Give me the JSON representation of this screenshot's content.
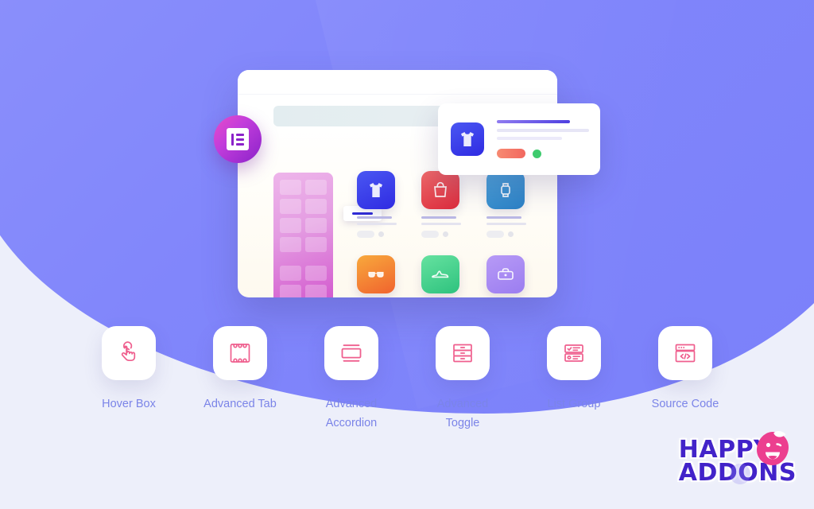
{
  "palette": {
    "background": "#edeffa",
    "blob_purple": "#8186fb",
    "label_text": "#7b84e8",
    "icon_pink": "#ef5f8e",
    "card_white": "#ffffff",
    "elementor_gradient_start": "#e84bc8",
    "elementor_gradient_end": "#8b22c9",
    "logo_purple": "#4223c9",
    "logo_pink": "#ec3f8f",
    "accent_blue": "#2f2be2",
    "status_green": "#3fcb6e",
    "action_orange": "#f2685f"
  },
  "hero": {
    "window": {
      "name": "browser-mockup",
      "search_placeholder": "",
      "side_panel_cells": 12,
      "tooltip_present": true
    },
    "elementor_badge": {
      "name": "elementor-logo-badge",
      "alt": "Elementor"
    },
    "products": [
      {
        "name": "tshirt",
        "icon": "tshirt-icon",
        "color_start": "#4a57f2",
        "color_end": "#2f2be2"
      },
      {
        "name": "bag-red",
        "icon": "handbag-icon",
        "color_start": "#f06a6a",
        "color_end": "#dc2b3c"
      },
      {
        "name": "watch-blue",
        "icon": "watch-icon",
        "color_start": "#4fa8dd",
        "color_end": "#2b7fc4"
      },
      {
        "name": "sunglasses",
        "icon": "sunglasses-icon",
        "color_start": "#f8a93c",
        "color_end": "#f0632e"
      },
      {
        "name": "shoe",
        "icon": "shoe-icon",
        "color_start": "#66e2a0",
        "color_end": "#2ec27e"
      },
      {
        "name": "briefcase",
        "icon": "briefcase-icon",
        "color_start": "#b79af6",
        "color_end": "#9b7df0"
      }
    ],
    "floating_card": {
      "name": "product-detail-card",
      "icon": "tshirt-icon",
      "button_label": "",
      "status": "in-stock"
    }
  },
  "widgets": [
    {
      "id": "hover-box",
      "label": "Hover Box",
      "icon": "hand-tap-icon"
    },
    {
      "id": "advanced-tab",
      "label": "Advanced Tab",
      "icon": "tabs-icon"
    },
    {
      "id": "advanced-accordion",
      "label": "Advanced\nAccordion",
      "icon": "accordion-icon"
    },
    {
      "id": "advanced-toggle",
      "label": "Advanced\nToggle",
      "icon": "toggle-rows-icon"
    },
    {
      "id": "list-group",
      "label": "List Group",
      "icon": "list-group-icon"
    },
    {
      "id": "source-code",
      "label": "Source Code",
      "icon": "code-window-icon"
    }
  ],
  "logo": {
    "line1": "HAPPY",
    "line2": "ADDONS",
    "mascot": "happy-face-icon"
  }
}
